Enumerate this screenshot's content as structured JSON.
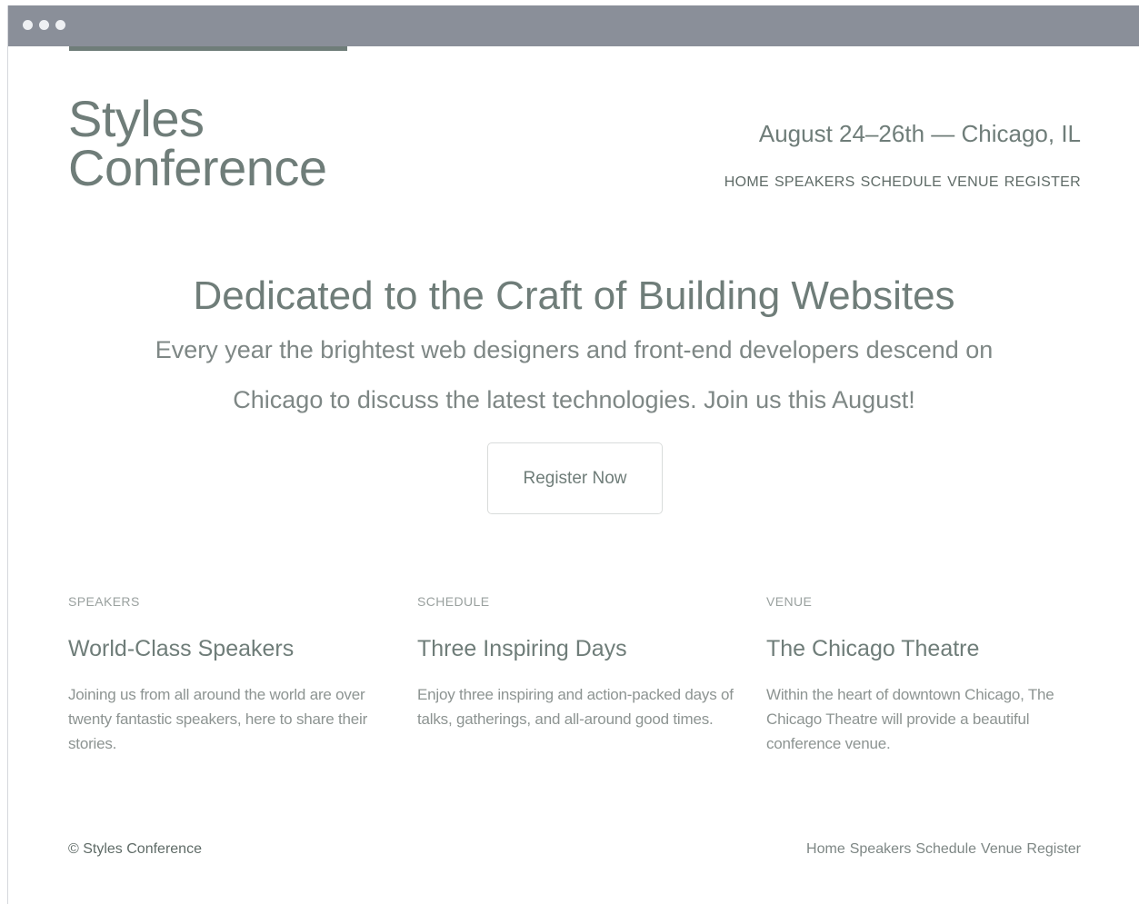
{
  "header": {
    "logo_line1": "Styles",
    "logo_line2": "Conference",
    "date_location": "August 24–26th — Chicago, IL",
    "nav": [
      "HOME",
      "SPEAKERS",
      "SCHEDULE",
      "VENUE",
      "REGISTER"
    ]
  },
  "hero": {
    "title": "Dedicated to the Craft of Building Websites",
    "text": "Every year the brightest web designers and front-end developers descend on Chicago to discuss the latest technologies. Join us this August!",
    "cta_label": "Register Now"
  },
  "teasers": [
    {
      "tag": "SPEAKERS",
      "title": "World-Class Speakers",
      "text": "Joining us from all around the world are over twenty fantastic speakers, here to share their stories."
    },
    {
      "tag": "SCHEDULE",
      "title": "Three Inspiring Days",
      "text": "Enjoy three inspiring and action-packed days of talks, gatherings, and all-around good times."
    },
    {
      "tag": "VENUE",
      "title": "The Chicago Theatre",
      "text": "Within the heart of downtown Chicago, The Chicago Theatre will provide a beautiful conference venue."
    }
  ],
  "footer": {
    "copyright": "© Styles Conference",
    "nav": [
      "Home",
      "Speakers",
      "Schedule",
      "Venue",
      "Register"
    ]
  },
  "colors": {
    "window_bar": "#8a8f99",
    "accent": "#6f7d79"
  }
}
